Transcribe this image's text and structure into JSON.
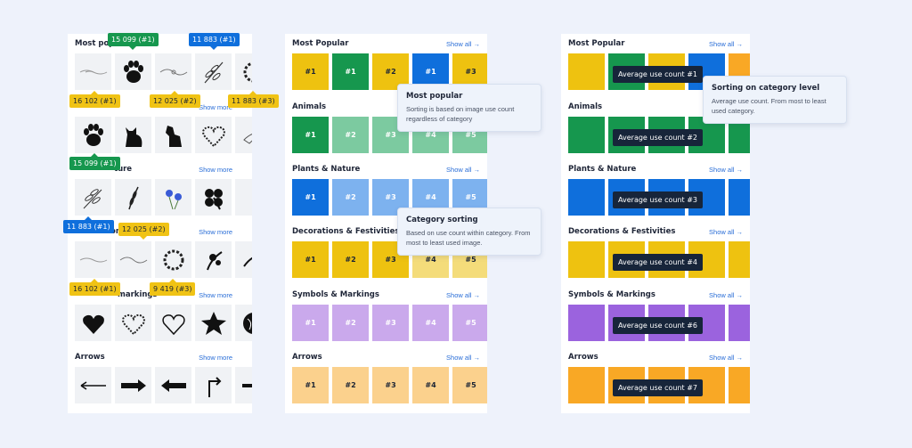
{
  "show_all_label": "Show more",
  "panel1": {
    "sections": [
      {
        "title": "Most popular",
        "action": "Show more"
      },
      {
        "title": "Animals",
        "action": "Show more"
      },
      {
        "title": "Plants & Nature",
        "action": "Show more"
      },
      {
        "title": "Decorations & Festivities",
        "action": "Show more"
      },
      {
        "title": "Symbols & Markings",
        "action": "Show more"
      },
      {
        "title": "Arrows",
        "action": "Show more"
      }
    ],
    "visible_titles": {
      "s0": "Most popul",
      "s2": "ture",
      "s3": "ons",
      "s4": "markings",
      "s5": "Arrows"
    },
    "badges": {
      "b1": "15 099 (#1)",
      "b2": "11 883 (#1)",
      "b3": "16 102 (#1)",
      "b4": "12 025 (#2)",
      "b5": "11 883 (#3)",
      "b6": "15 099 (#1)",
      "b7": "11 883 (#1)",
      "b8": "12 025 (#2)",
      "b9": "16 102 (#1)",
      "b10": "9 419 (#3)"
    },
    "icons": [
      [
        "divider-ornament-icon",
        "paw-icon",
        "swirl-ornament-icon",
        "laurel-branch-icon",
        "wreath-icon"
      ],
      [
        "paw-icon",
        "cat-icon",
        "dog-icon",
        "heart-pattern-icon",
        "bird-icon"
      ],
      [
        "leaf-branch-icon",
        "wheat-icon",
        "flowers-icon",
        "clover-icon",
        "poppy-icon"
      ],
      [
        "divider-ornament-icon",
        "swirl-ornament-icon",
        "wreath-icon",
        "floral-corner-icon",
        "swallow-icon"
      ],
      [
        "heart-icon",
        "heart-pattern-icon",
        "heart-outline-icon",
        "star-icon",
        "globe-icon"
      ],
      [
        "arrow-left-icon",
        "arrow-right-icon",
        "arrow-left-bold-icon",
        "arrow-turn-icon",
        "arrow-line-icon"
      ]
    ]
  },
  "panel2": {
    "show_all": "Show all",
    "sections": [
      {
        "title": "Most Popular",
        "tiles": [
          "#1",
          "#1",
          "#2",
          "#1",
          "#3"
        ],
        "colors": [
          "#eec210",
          "#16974e",
          "#eec210",
          "#0f6fdc",
          "#eec210"
        ]
      },
      {
        "title": "Animals",
        "tiles": [
          "#1",
          "#2",
          "#3",
          "#4",
          "#5"
        ],
        "colors": [
          "#16974e",
          "#7ccaa0",
          "#7ccaa0",
          "#7ccaa0",
          "#7ccaa0"
        ]
      },
      {
        "title": "Plants & Nature",
        "tiles": [
          "#1",
          "#2",
          "#3",
          "#4",
          "#5"
        ],
        "colors": [
          "#0f6fdc",
          "#7db2ef",
          "#7db2ef",
          "#7db2ef",
          "#7db2ef"
        ]
      },
      {
        "title": "Decorations & Festivities",
        "tiles": [
          "#1",
          "#2",
          "#3",
          "#4",
          "#5"
        ],
        "colors": [
          "#eec210",
          "#eec210",
          "#eec210",
          "#f4dc7a",
          "#f4dc7a"
        ]
      },
      {
        "title": "Symbols & Markings",
        "tiles": [
          "#1",
          "#2",
          "#3",
          "#4",
          "#5"
        ],
        "colors": [
          "#caa9ec",
          "#caa9ec",
          "#caa9ec",
          "#caa9ec",
          "#caa9ec"
        ]
      },
      {
        "title": "Arrows",
        "tiles": [
          "#1",
          "#2",
          "#3",
          "#4",
          "#5"
        ],
        "colors": [
          "#fbd18d",
          "#fbd18d",
          "#fbd18d",
          "#fbd18d",
          "#fbd18d"
        ]
      }
    ],
    "tooltip1": {
      "title": "Most popular",
      "body": "Sorting is based on image use count regardless of category"
    },
    "tooltip2": {
      "title": "Category sorting",
      "body": "Based on use count within category. From most to least used image."
    }
  },
  "panel3": {
    "show_all": "Show all",
    "sections": [
      {
        "title": "Most Popular",
        "color": "#eec210",
        "colors": [
          "#eec210",
          "#16974e",
          "#eec210",
          "#0f6fdc",
          "#f9a825"
        ],
        "avg": "Average use count #1"
      },
      {
        "title": "Animals",
        "color": "#16974e",
        "avg": "Average use count #2"
      },
      {
        "title": "Plants & Nature",
        "color": "#0f6fdc",
        "avg": "Average use count #3"
      },
      {
        "title": "Decorations & Festivities",
        "color": "#eec210",
        "avg": "Average use count #4"
      },
      {
        "title": "Symbols & Markings",
        "color": "#9b63de",
        "avg": "Average use count #6"
      },
      {
        "title": "Arrows",
        "color": "#f9a825",
        "avg": "Average use count #7"
      }
    ],
    "tooltip": {
      "title": "Sorting on category level",
      "body": "Average use count. From most to least used category."
    }
  }
}
